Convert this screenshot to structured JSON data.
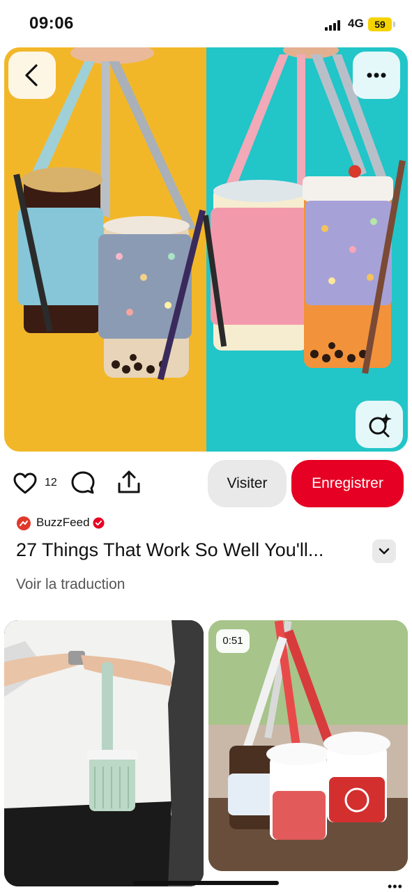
{
  "status_bar": {
    "time": "09:06",
    "network": "4G",
    "battery": "59"
  },
  "pin": {
    "like_count": "12",
    "visit_label": "Visiter",
    "save_label": "Enregistrer",
    "source_name": "BuzzFeed",
    "title": "27 Things That Work So Well You'll...",
    "translate_label": "Voir la traduction"
  },
  "related": {
    "video_duration": "0:51"
  },
  "icons": {
    "back": "chevron-left-icon",
    "more": "more-horizontal-icon",
    "lens": "visual-search-icon",
    "like": "heart-icon",
    "comment": "comment-icon",
    "share": "share-icon",
    "verified": "verified-check-icon",
    "expand": "chevron-down-icon"
  },
  "colors": {
    "save_button": "#e60023",
    "visit_button": "#e9e9e9",
    "hero_left": "#f2b729",
    "hero_right": "#22c5c8",
    "battery": "#f5d300"
  }
}
